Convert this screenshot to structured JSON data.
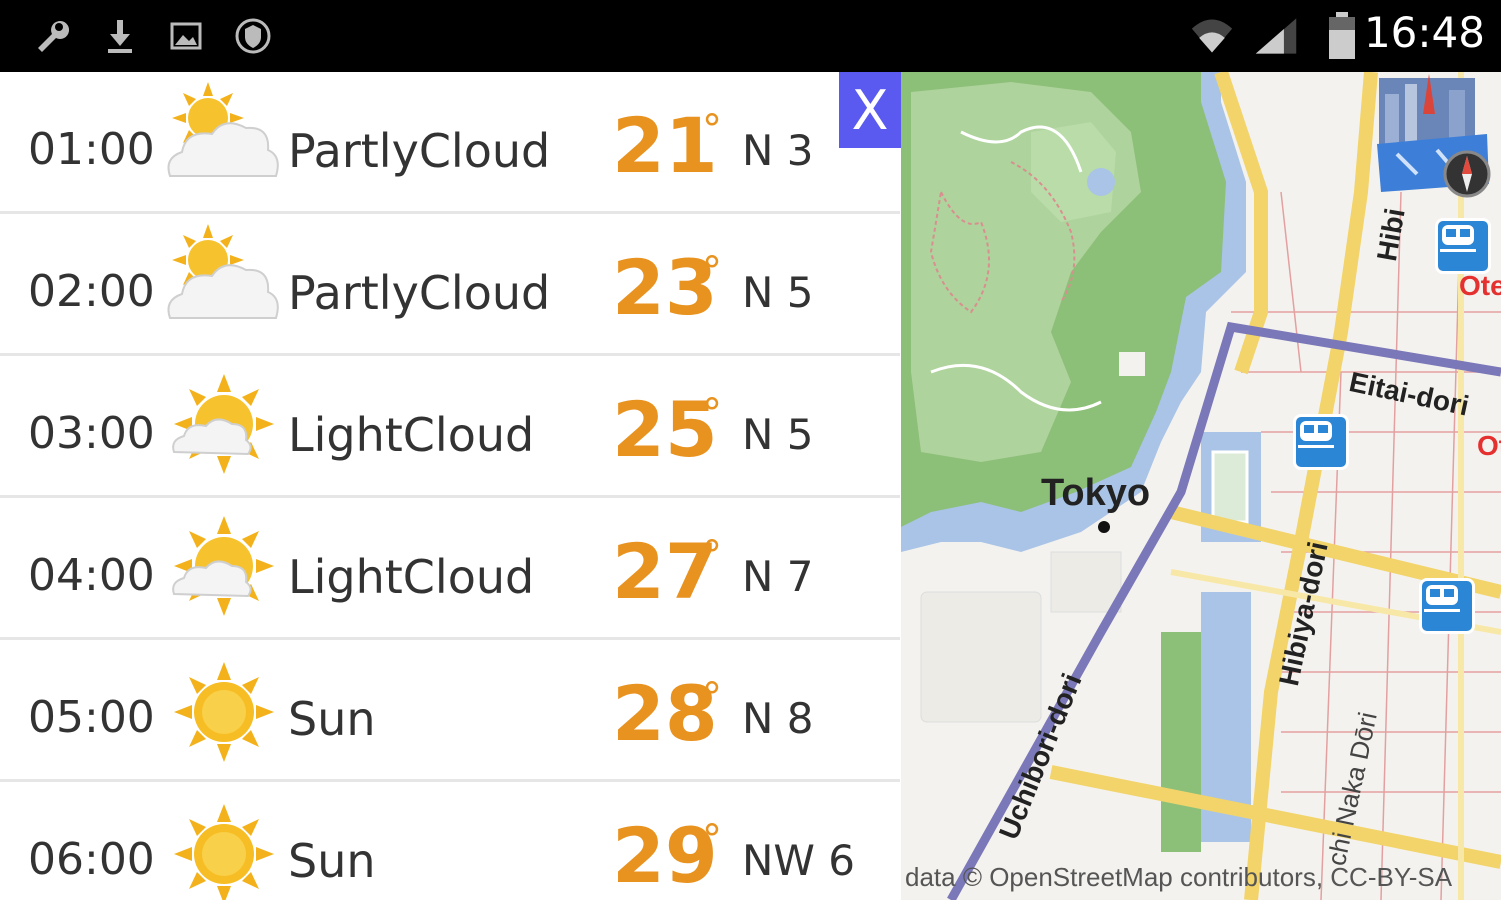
{
  "status_bar": {
    "icons": [
      "wrench-icon",
      "download-icon",
      "image-icon",
      "shield-icon"
    ],
    "right_icons": [
      "wifi-icon",
      "signal-icon",
      "battery-icon"
    ],
    "time": "16:48"
  },
  "close_button": {
    "label": "X"
  },
  "forecast": [
    {
      "time": "01:00",
      "icon": "partly-cloudy-icon",
      "condition": "PartlyCloud",
      "temp": "21",
      "deg": "°",
      "wind": "N 3"
    },
    {
      "time": "02:00",
      "icon": "partly-cloudy-icon",
      "condition": "PartlyCloud",
      "temp": "23",
      "deg": "°",
      "wind": "N 5"
    },
    {
      "time": "03:00",
      "icon": "light-cloud-icon",
      "condition": "LightCloud",
      "temp": "25",
      "deg": "°",
      "wind": "N 5"
    },
    {
      "time": "04:00",
      "icon": "light-cloud-icon",
      "condition": "LightCloud",
      "temp": "27",
      "deg": "°",
      "wind": "N 7"
    },
    {
      "time": "05:00",
      "icon": "sun-icon",
      "condition": "Sun",
      "temp": "28",
      "deg": "°",
      "wind": "N 8"
    },
    {
      "time": "06:00",
      "icon": "sun-icon",
      "condition": "Sun",
      "temp": "29",
      "deg": "°",
      "wind": "NW 6"
    }
  ],
  "map": {
    "city_label": "Tokyo",
    "street_labels": [
      "Eitai-dori",
      "Hibiya-dori",
      "Uchibori-dori",
      "Hibi",
      "Ote",
      "Ot",
      "chi Naka Dōri"
    ],
    "attribution": "data © OpenStreetMap contributors, CC-BY-SA",
    "colors": {
      "park": "#8cbf78",
      "water": "#a9c4e6",
      "road_major": "#f2d46b",
      "route": "#7a78b8"
    }
  },
  "colors": {
    "temp": "#e8921f",
    "close_button": "#5a5af0"
  }
}
